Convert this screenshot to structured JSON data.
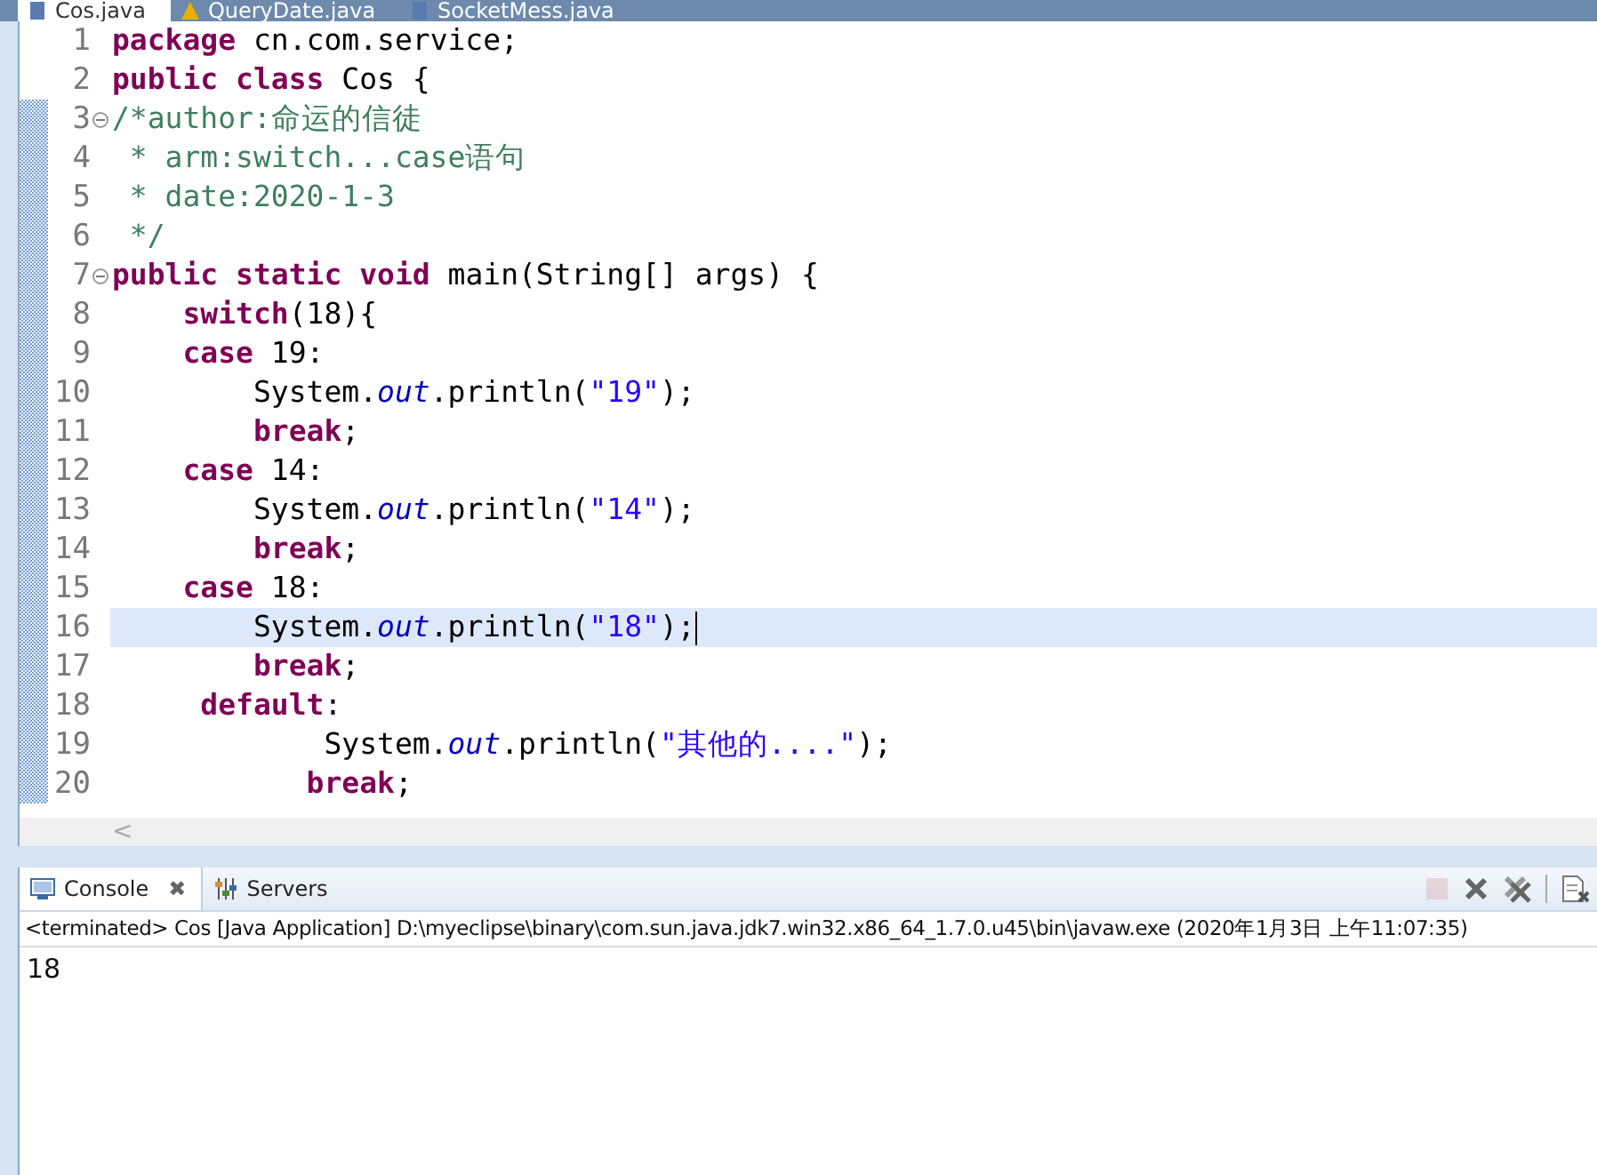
{
  "editor_tabs": [
    {
      "label": "Cos.java",
      "selected": true,
      "warning": false
    },
    {
      "label": "QueryDate.java",
      "selected": false,
      "warning": true
    },
    {
      "label": "SocketMess.java",
      "selected": false,
      "warning": false
    }
  ],
  "code_lines": [
    {
      "number": "1",
      "foldable": false,
      "current": false,
      "tokens": [
        {
          "kind": "kw",
          "text": "package"
        },
        {
          "kind": "plain",
          "text": " cn.com.service;"
        }
      ]
    },
    {
      "number": "2",
      "foldable": false,
      "current": false,
      "tokens": [
        {
          "kind": "kw",
          "text": "public"
        },
        {
          "kind": "kw",
          "text": " class"
        },
        {
          "kind": "plain",
          "text": " Cos {"
        }
      ]
    },
    {
      "number": "3",
      "foldable": true,
      "current": false,
      "tokens": [
        {
          "kind": "comment",
          "text": "/*author:命运的信徒"
        }
      ]
    },
    {
      "number": "4",
      "foldable": false,
      "current": false,
      "tokens": [
        {
          "kind": "comment",
          "text": " * arm:switch...case语句"
        }
      ]
    },
    {
      "number": "5",
      "foldable": false,
      "current": false,
      "tokens": [
        {
          "kind": "comment",
          "text": " * date:2020-1-3"
        }
      ]
    },
    {
      "number": "6",
      "foldable": false,
      "current": false,
      "tokens": [
        {
          "kind": "comment",
          "text": " */"
        }
      ]
    },
    {
      "number": "7",
      "foldable": true,
      "current": false,
      "tokens": [
        {
          "kind": "kw",
          "text": "public"
        },
        {
          "kind": "kw",
          "text": " static"
        },
        {
          "kind": "kw",
          "text": " void"
        },
        {
          "kind": "plain",
          "text": " main(String[] args) {"
        }
      ]
    },
    {
      "number": "8",
      "foldable": false,
      "current": false,
      "tokens": [
        {
          "kind": "kw",
          "text": "    switch"
        },
        {
          "kind": "plain",
          "text": "(18){"
        }
      ]
    },
    {
      "number": "9",
      "foldable": false,
      "current": false,
      "tokens": [
        {
          "kind": "kw",
          "text": "    case"
        },
        {
          "kind": "plain",
          "text": " 19:"
        }
      ]
    },
    {
      "number": "10",
      "foldable": false,
      "current": false,
      "tokens": [
        {
          "kind": "plain",
          "text": "        System."
        },
        {
          "kind": "field",
          "text": "out"
        },
        {
          "kind": "plain",
          "text": ".println("
        },
        {
          "kind": "str",
          "text": "\"19\""
        },
        {
          "kind": "plain",
          "text": ");"
        }
      ]
    },
    {
      "number": "11",
      "foldable": false,
      "current": false,
      "tokens": [
        {
          "kind": "kw",
          "text": "        break"
        },
        {
          "kind": "plain",
          "text": ";"
        }
      ]
    },
    {
      "number": "12",
      "foldable": false,
      "current": false,
      "tokens": [
        {
          "kind": "kw",
          "text": "    case"
        },
        {
          "kind": "plain",
          "text": " 14:"
        }
      ]
    },
    {
      "number": "13",
      "foldable": false,
      "current": false,
      "tokens": [
        {
          "kind": "plain",
          "text": "        System."
        },
        {
          "kind": "field",
          "text": "out"
        },
        {
          "kind": "plain",
          "text": ".println("
        },
        {
          "kind": "str",
          "text": "\"14\""
        },
        {
          "kind": "plain",
          "text": ");"
        }
      ]
    },
    {
      "number": "14",
      "foldable": false,
      "current": false,
      "tokens": [
        {
          "kind": "kw",
          "text": "        break"
        },
        {
          "kind": "plain",
          "text": ";"
        }
      ]
    },
    {
      "number": "15",
      "foldable": false,
      "current": false,
      "tokens": [
        {
          "kind": "kw",
          "text": "    case"
        },
        {
          "kind": "plain",
          "text": " 18:"
        }
      ]
    },
    {
      "number": "16",
      "foldable": false,
      "current": true,
      "tokens": [
        {
          "kind": "plain",
          "text": "        System."
        },
        {
          "kind": "field",
          "text": "out"
        },
        {
          "kind": "plain",
          "text": ".println("
        },
        {
          "kind": "str",
          "text": "\"18\""
        },
        {
          "kind": "plain",
          "text": ");"
        }
      ]
    },
    {
      "number": "17",
      "foldable": false,
      "current": false,
      "tokens": [
        {
          "kind": "kw",
          "text": "        break"
        },
        {
          "kind": "plain",
          "text": ";"
        }
      ]
    },
    {
      "number": "18",
      "foldable": false,
      "current": false,
      "tokens": [
        {
          "kind": "kw",
          "text": "     default"
        },
        {
          "kind": "plain",
          "text": ":"
        }
      ]
    },
    {
      "number": "19",
      "foldable": false,
      "current": false,
      "tokens": [
        {
          "kind": "plain",
          "text": "            System."
        },
        {
          "kind": "field",
          "text": "out"
        },
        {
          "kind": "plain",
          "text": ".println("
        },
        {
          "kind": "str",
          "text": "\"其他的....\""
        },
        {
          "kind": "plain",
          "text": ");"
        }
      ]
    },
    {
      "number": "20",
      "foldable": false,
      "current": false,
      "tokens": [
        {
          "kind": "kw",
          "text": "           break"
        },
        {
          "kind": "plain",
          "text": ";"
        }
      ]
    }
  ],
  "scroll_left": "<",
  "console_tabs": [
    {
      "label": "Console",
      "selected": true,
      "close": "✖"
    },
    {
      "label": "Servers",
      "selected": false
    }
  ],
  "console_toolbar": [
    {
      "kind": "stop",
      "disabled": true
    },
    {
      "kind": "remove",
      "disabled": false
    },
    {
      "kind": "remove_all",
      "disabled": false
    },
    {
      "kind": "separator"
    },
    {
      "kind": "clear",
      "disabled": false
    }
  ],
  "console_status": "<terminated> Cos [Java Application] D:\\myeclipse\\binary\\com.sun.java.jdk7.win32.x86_64_1.7.0.u45\\bin\\javaw.exe (2020年1月3日 上午11:07:35)",
  "console_output": "18"
}
